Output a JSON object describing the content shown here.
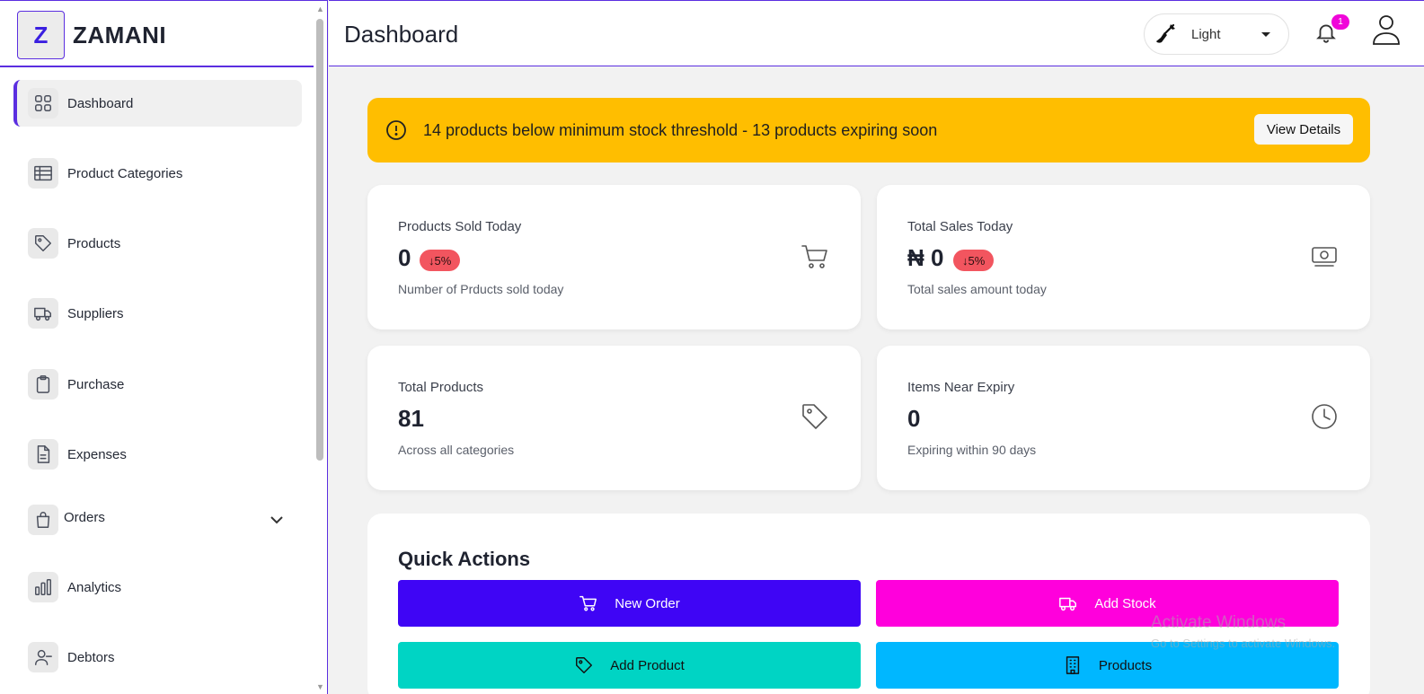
{
  "brand": {
    "logo_letter": "Z",
    "name": "ZAMANI"
  },
  "sidebar": {
    "items": [
      {
        "label": "Dashboard",
        "icon": "grid-icon"
      },
      {
        "label": "Product Categories",
        "icon": "table-icon"
      },
      {
        "label": "Products",
        "icon": "tag-icon"
      },
      {
        "label": "Suppliers",
        "icon": "truck-icon"
      },
      {
        "label": "Purchase",
        "icon": "clipboard-icon"
      },
      {
        "label": "Expenses",
        "icon": "document-icon"
      },
      {
        "label": "Orders",
        "icon": "shopping-bag-icon"
      },
      {
        "label": "Analytics",
        "icon": "bar-chart-icon"
      },
      {
        "label": "Debtors",
        "icon": "user-minus-icon"
      }
    ]
  },
  "header": {
    "title": "Dashboard",
    "theme_label": "Light",
    "notification_count": "1"
  },
  "alert": {
    "message": "14 products below minimum stock threshold - 13 products expiring soon",
    "button_label": "View Details"
  },
  "stats": [
    {
      "title": "Products Sold Today",
      "value": "0",
      "badge": "↓5%",
      "subtitle": "Number of Prducts sold today",
      "icon": "cart-icon"
    },
    {
      "title": "Total Sales Today",
      "value": "₦ 0",
      "badge": "↓5%",
      "subtitle": "Total sales amount today",
      "icon": "cash-icon"
    },
    {
      "title": "Total Products",
      "value": "81",
      "subtitle": "Across all categories",
      "icon": "tag-icon"
    },
    {
      "title": "Items Near Expiry",
      "value": "0",
      "subtitle": "Expiring within 90 days",
      "icon": "clock-icon"
    }
  ],
  "quick_actions": {
    "title": "Quick Actions",
    "buttons": [
      {
        "label": "New Order",
        "icon": "cart-icon",
        "color": "#3f05f5"
      },
      {
        "label": "Add Stock",
        "icon": "truck-icon",
        "color": "#ff00dc"
      },
      {
        "label": "Add Product",
        "icon": "tag-icon",
        "color": "#00d4c4"
      },
      {
        "label": "Products",
        "icon": "building-icon",
        "color": "#00b7ff"
      }
    ]
  },
  "watermark": {
    "title": "Activate Windows",
    "subtitle": "Go to Settings to activate Windows."
  },
  "colors": {
    "accent": "#5b2ee0",
    "alert": "#ffbe00",
    "badge_red": "#f2555f",
    "notification": "#f006d9"
  }
}
